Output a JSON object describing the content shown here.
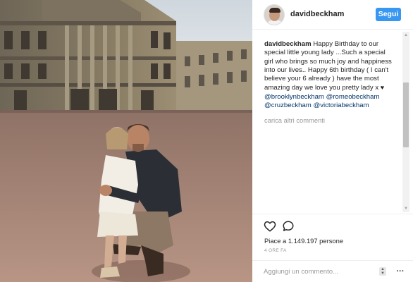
{
  "post": {
    "username": "davidbeckham",
    "follow_label": "Segui"
  },
  "caption": {
    "username": "davidbeckham",
    "text": "Happy Birthday to our special little young lady ...Such a special girl who brings so much joy and happiness into our lives.. Happy 6th birthday ( I can't believe your 6 already ) have the most amazing day we love you pretty lady x",
    "heart": "♥",
    "mentions": [
      "@brooklynbeckham",
      "@romeobeckham",
      "@cruzbeckham",
      "@victoriabeckham"
    ]
  },
  "load_more_label": "carica altri commenti",
  "likes_text": "Piace a 1.149.197 persone",
  "time_text": "4 ORE FA",
  "comment_placeholder": "Aggiungi un commento...",
  "icons": {
    "like": "heart-outline-icon",
    "comment": "speech-bubble-icon",
    "more": "updown-arrows-icon",
    "options": "ellipsis-icon"
  },
  "colors": {
    "follow_button": "#3897f0",
    "mention": "#003569",
    "meta_gray": "#999999"
  }
}
